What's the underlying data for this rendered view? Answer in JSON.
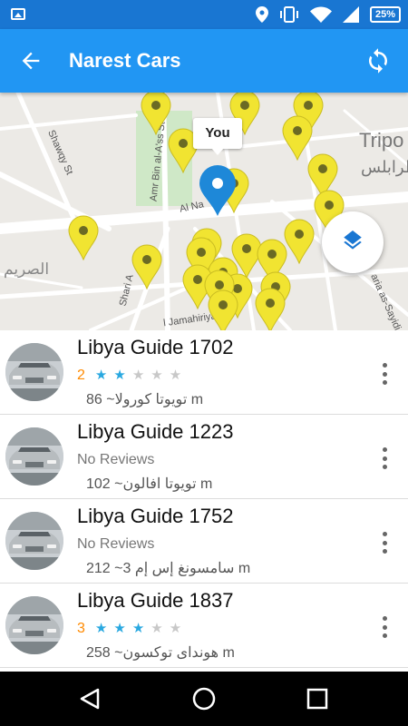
{
  "status_bar": {
    "battery": "25%",
    "icons": [
      "image-icon",
      "location-icon",
      "vibrate-icon",
      "wifi-icon",
      "signal-icon",
      "battery-icon"
    ]
  },
  "app_bar": {
    "title": "Narest Cars",
    "back_icon": "arrow-back-icon",
    "refresh_icon": "sync-icon"
  },
  "map": {
    "you_label": "You",
    "labels": {
      "shawqy": "Shawqy St",
      "amr": "Amr Bin al-A'ss St",
      "al_na": "Al Na",
      "shari_a": "Shari A",
      "jamahiriyah": "l Jamahiriyah St",
      "aria": "aria as-Sayidi",
      "tripo": "Tripo",
      "tripoli_ar": "طرابلس",
      "dahra_ar": "الصريم"
    },
    "layers_icon": "layers-icon",
    "colors": {
      "pin": "#f1e431",
      "pin_dot": "#6b6a24",
      "user_pin": "#1e88d8"
    }
  },
  "cars": [
    {
      "name": "Libya Guide 1702",
      "rating": "2",
      "stars": 2,
      "reviews_text": "",
      "model": "تويوتا كورولا",
      "distance": "~ 86 m"
    },
    {
      "name": "Libya Guide 1223",
      "rating": "",
      "stars": 0,
      "reviews_text": "No Reviews",
      "model": "تويوتا افالون",
      "distance": "~ 102 m"
    },
    {
      "name": "Libya Guide 1752",
      "rating": "",
      "stars": 0,
      "reviews_text": "No Reviews",
      "model": "سامسونغ إس إم 3",
      "distance": "~ 212 m"
    },
    {
      "name": "Libya Guide 1837",
      "rating": "3",
      "stars": 3,
      "reviews_text": "",
      "model": "هونداى توكسون",
      "distance": "~ 258 m"
    }
  ],
  "colors": {
    "status_bar": "#1976d2",
    "app_bar": "#2196f3",
    "star_filled": "#29a8e0",
    "star_empty": "#c8c8c8",
    "rating_number": "#ff8a00"
  },
  "nav_bar": {
    "icons": [
      "back-triangle-icon",
      "home-circle-icon",
      "recents-square-icon"
    ]
  }
}
